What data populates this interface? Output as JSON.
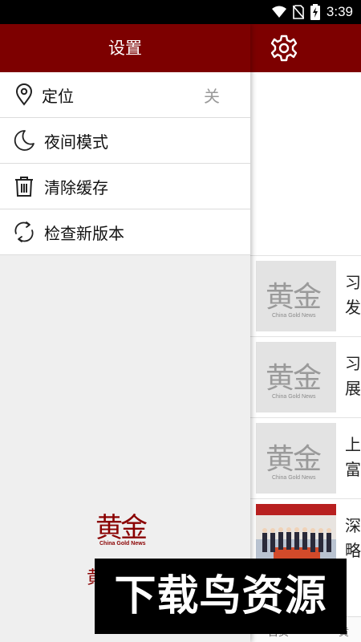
{
  "status_bar": {
    "time": "3:39"
  },
  "drawer": {
    "title": "设置",
    "items": [
      {
        "label": "定位",
        "value": "关",
        "icon": "location-pin-icon"
      },
      {
        "label": "夜间模式",
        "icon": "moon-icon"
      },
      {
        "label": "清除缓存",
        "icon": "trash-icon"
      },
      {
        "label": "检查新版本",
        "icon": "refresh-icon"
      }
    ],
    "brand": {
      "logo": "黄金",
      "sub": "China Gold News",
      "label": "黄"
    }
  },
  "main": {
    "news": [
      {
        "title": "习\n发",
        "thumb": "placeholder"
      },
      {
        "title": "习\n展",
        "thumb": "placeholder"
      },
      {
        "title": "上\n富",
        "thumb": "placeholder"
      },
      {
        "title": "深\n略",
        "thumb": "photo"
      }
    ],
    "thumb_logo": "黄金",
    "thumb_sub": "China Gold News",
    "bottom_nav": {
      "left": "首页",
      "right": "黄"
    }
  },
  "watermark": "下载鸟资源",
  "colors": {
    "brand": "#7d0000",
    "status_bar": "#000000"
  }
}
